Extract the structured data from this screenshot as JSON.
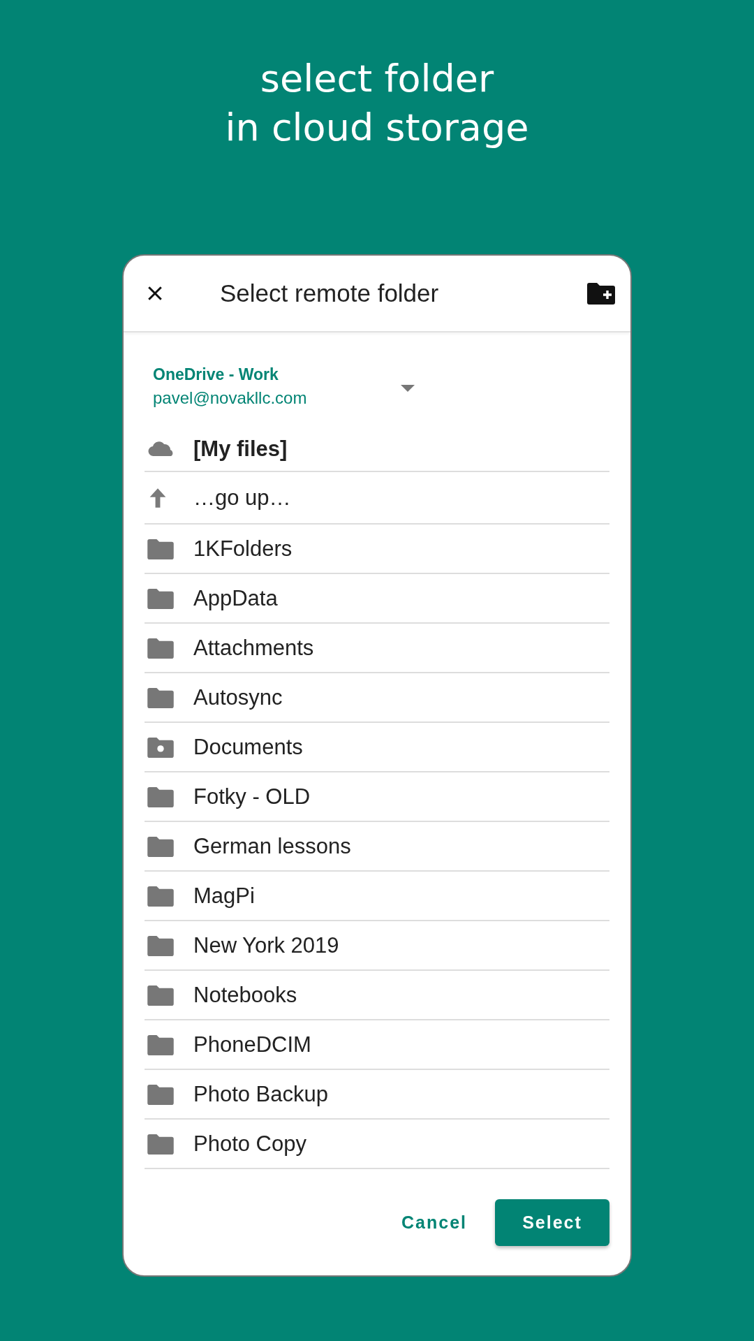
{
  "headline": "select folder\nin cloud storage",
  "dialog": {
    "title": "Select remote folder",
    "account": {
      "service": "OneDrive - Work",
      "email": "pavel@novakllc.com"
    },
    "items": [
      {
        "kind": "root",
        "label": "[My files]"
      },
      {
        "kind": "up",
        "label": "…go up…"
      },
      {
        "kind": "folder",
        "label": "1KFolders"
      },
      {
        "kind": "folder",
        "label": "AppData"
      },
      {
        "kind": "folder",
        "label": "Attachments"
      },
      {
        "kind": "folder",
        "label": "Autosync"
      },
      {
        "kind": "special",
        "label": "Documents"
      },
      {
        "kind": "folder",
        "label": "Fotky - OLD"
      },
      {
        "kind": "folder",
        "label": "German lessons"
      },
      {
        "kind": "folder",
        "label": "MagPi"
      },
      {
        "kind": "folder",
        "label": "New York 2019"
      },
      {
        "kind": "folder",
        "label": "Notebooks"
      },
      {
        "kind": "folder",
        "label": "PhoneDCIM"
      },
      {
        "kind": "folder",
        "label": "Photo Backup"
      },
      {
        "kind": "folder",
        "label": "Photo Copy"
      }
    ],
    "buttons": [
      {
        "kind": "text",
        "label": "Cancel"
      },
      {
        "kind": "filled",
        "label": "Select"
      }
    ]
  }
}
